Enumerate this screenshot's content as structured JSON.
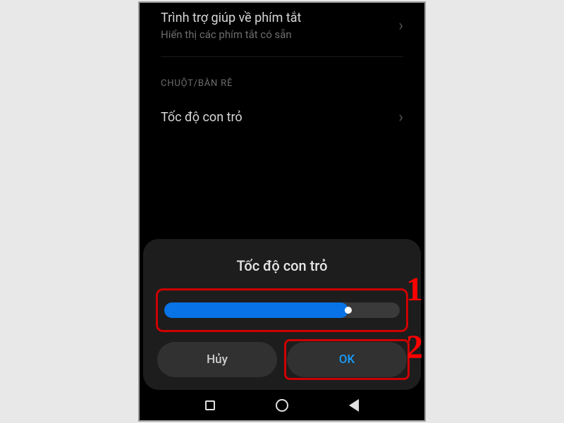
{
  "settings": {
    "shortcut": {
      "title": "Trình trợ giúp về phím tắt",
      "subtitle": "Hiển thị các phím tắt có sẵn"
    },
    "section_header": "CHUỘT/BÀN RÊ",
    "pointer": {
      "title": "Tốc độ con trỏ"
    }
  },
  "dialog": {
    "title": "Tốc độ con trỏ",
    "slider_percent": 78,
    "cancel_label": "Hủy",
    "ok_label": "OK"
  },
  "annotations": {
    "step1": "1",
    "step2": "2"
  }
}
